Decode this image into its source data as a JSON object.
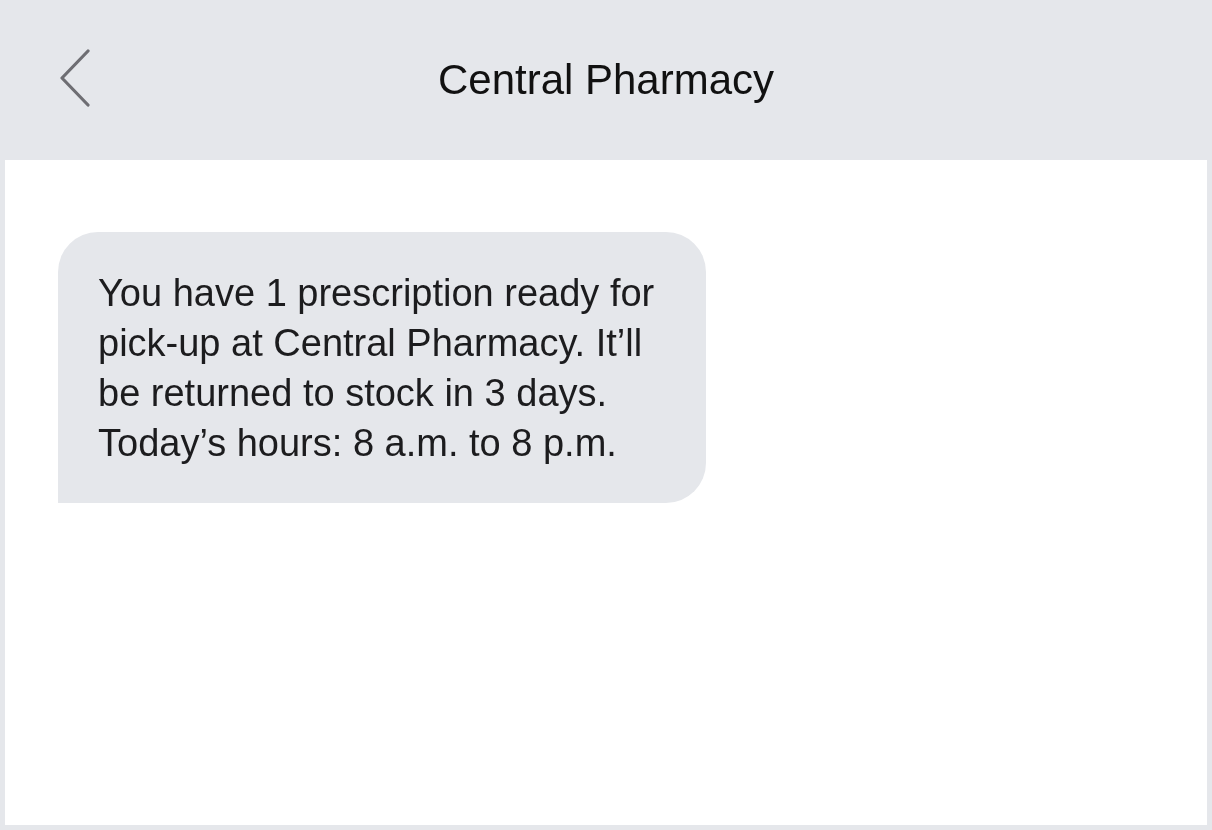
{
  "header": {
    "title": "Central Pharmacy"
  },
  "messages": [
    {
      "kind": "incoming",
      "text": "You have 1 prescription ready for pick-up at Central Pharmacy. It’ll be returned to stock in 3 days. Today’s hours: 8 a.m. to 8 p.m."
    }
  ]
}
